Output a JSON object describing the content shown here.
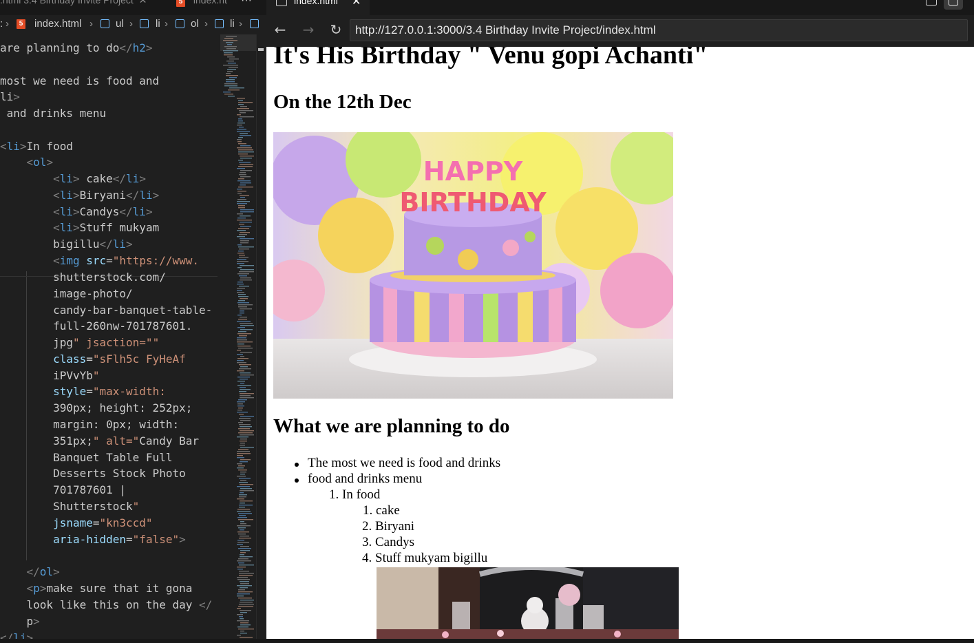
{
  "editor": {
    "tabs": [
      {
        "label": ".html  3.4 Birthday Invite Project",
        "close": "✕"
      },
      {
        "label": "index.ht"
      }
    ],
    "more": "···",
    "breadcrumb": [
      ":",
      "index.html",
      "ul",
      "li",
      "ol",
      "li"
    ],
    "code_lines": [
      "are planning to do</h2>",
      "",
      "most we need is food and",
      "li>",
      " and drinks menu",
      "",
      "<li>In food",
      "    <ol>",
      "        <li> cake</li>",
      "        <li>Biryani</li>",
      "        <li>Candys</li>",
      "        <li>Stuff mukyam",
      "        bigillu</li>",
      "        <img src=\"https://www.",
      "        shutterstock.com/",
      "        image-photo/",
      "        candy-bar-banquet-table-",
      "        full-260nw-701787601.",
      "        jpg\" jsaction=\"\"",
      "        class=\"sFlh5c FyHeAf",
      "        iPVvYb\"",
      "        style=\"max-width:",
      "        390px; height: 252px;",
      "        margin: 0px; width:",
      "        351px;\" alt=\"Candy Bar",
      "        Banquet Table Full",
      "        Desserts Stock Photo",
      "        701787601 |",
      "        Shutterstock\"",
      "        jsname=\"kn3ccd\"",
      "        aria-hidden=\"false\">",
      "",
      "    </ol>",
      "    <p>make sure that it gona",
      "    look like this on the day </",
      "    p>",
      "</li>"
    ]
  },
  "browser": {
    "tab_title": "index.html",
    "tab_close": "✕",
    "back_icon": "←",
    "forward_icon": "→",
    "reload_icon": "↻",
    "url": "http://127.0.0.1:3000/3.4 Birthday Invite Project/index.html"
  },
  "page": {
    "title": "It's His Birthday \" Venu gopi Achanti\"",
    "date": "On the 12th Dec",
    "cake_text_1": "HAPPY",
    "cake_text_2": "BIRTHDAY",
    "section_heading": "What we are planning to do",
    "bullets": [
      "The most we need is food and drinks",
      "food and drinks menu"
    ],
    "food_item": "1. In food",
    "food_list": [
      "1. cake",
      "2. Biryani",
      "3. Candys",
      "4. Stuff mukyam bigillu"
    ]
  },
  "colors": {
    "editor_bg": "#1f1f1f",
    "tag": "#569cd6",
    "attr": "#9cdcfe",
    "string": "#ce9178"
  }
}
